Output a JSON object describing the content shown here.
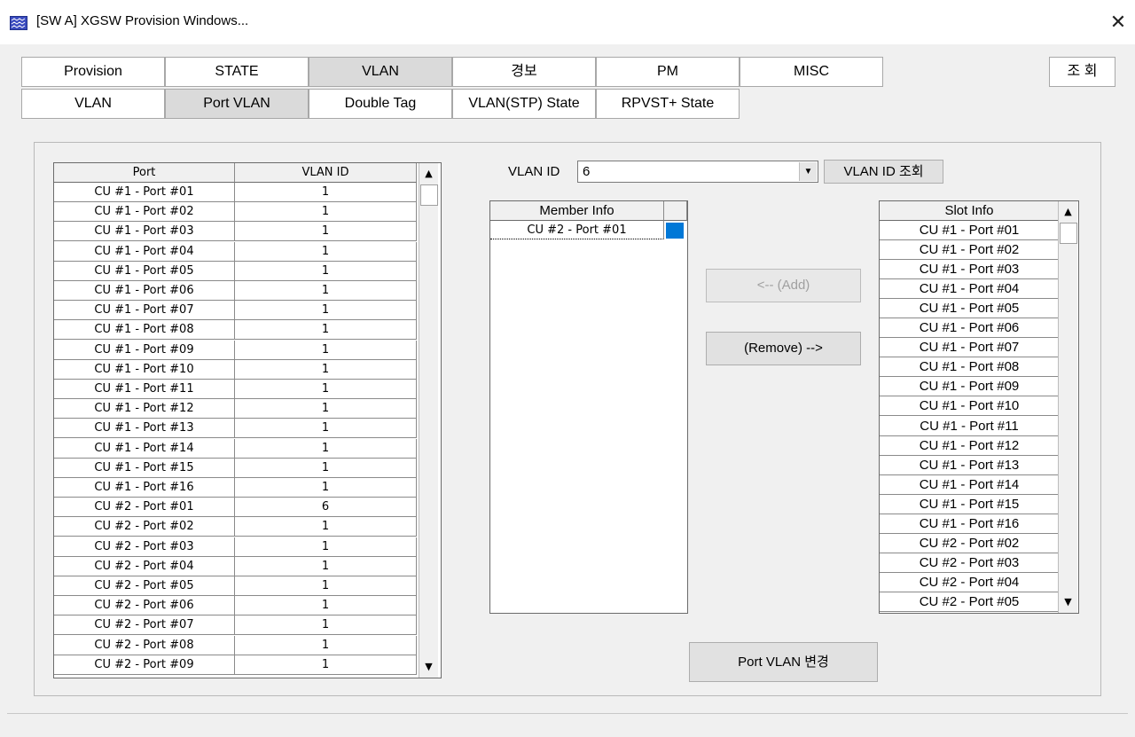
{
  "window": {
    "title": "[SW A] XGSW Provision Windows...",
    "close_glyph": "✕"
  },
  "top_tabs": [
    {
      "label": "Provision"
    },
    {
      "label": "STATE"
    },
    {
      "label": "VLAN"
    },
    {
      "label": "경보"
    },
    {
      "label": "PM"
    },
    {
      "label": "MISC"
    }
  ],
  "query_button": "조 회",
  "sub_tabs": [
    {
      "label": "VLAN"
    },
    {
      "label": "Port VLAN"
    },
    {
      "label": "Double Tag"
    },
    {
      "label": "VLAN(STP) State"
    },
    {
      "label": "RPVST+ State"
    }
  ],
  "port_table": {
    "headers": [
      "Port",
      "VLAN ID"
    ],
    "rows": [
      [
        "CU #1 - Port #01",
        "1"
      ],
      [
        "CU #1 - Port #02",
        "1"
      ],
      [
        "CU #1 - Port #03",
        "1"
      ],
      [
        "CU #1 - Port #04",
        "1"
      ],
      [
        "CU #1 - Port #05",
        "1"
      ],
      [
        "CU #1 - Port #06",
        "1"
      ],
      [
        "CU #1 - Port #07",
        "1"
      ],
      [
        "CU #1 - Port #08",
        "1"
      ],
      [
        "CU #1 - Port #09",
        "1"
      ],
      [
        "CU #1 - Port #10",
        "1"
      ],
      [
        "CU #1 - Port #11",
        "1"
      ],
      [
        "CU #1 - Port #12",
        "1"
      ],
      [
        "CU #1 - Port #13",
        "1"
      ],
      [
        "CU #1 - Port #14",
        "1"
      ],
      [
        "CU #1 - Port #15",
        "1"
      ],
      [
        "CU #1 - Port #16",
        "1"
      ],
      [
        "CU #2 - Port #01",
        "6"
      ],
      [
        "CU #2 - Port #02",
        "1"
      ],
      [
        "CU #2 - Port #03",
        "1"
      ],
      [
        "CU #2 - Port #04",
        "1"
      ],
      [
        "CU #2 - Port #05",
        "1"
      ],
      [
        "CU #2 - Port #06",
        "1"
      ],
      [
        "CU #2 - Port #07",
        "1"
      ],
      [
        "CU #2 - Port #08",
        "1"
      ],
      [
        "CU #2 - Port #09",
        "1"
      ]
    ]
  },
  "vlan_id": {
    "label": "VLAN ID",
    "value": "6",
    "lookup_button": "VLAN ID  조회"
  },
  "member_info": {
    "header": "Member Info",
    "rows": [
      "CU #2 - Port #01"
    ]
  },
  "add_button": "<-- (Add)",
  "remove_button": "(Remove) -->",
  "slot_info": {
    "header": "Slot Info",
    "rows": [
      "CU #1 - Port #01",
      "CU #1 - Port #02",
      "CU #1 - Port #03",
      "CU #1 - Port #04",
      "CU #1 - Port #05",
      "CU #1 - Port #06",
      "CU #1 - Port #07",
      "CU #1 - Port #08",
      "CU #1 - Port #09",
      "CU #1 - Port #10",
      "CU #1 - Port #11",
      "CU #1 - Port #12",
      "CU #1 - Port #13",
      "CU #1 - Port #14",
      "CU #1 - Port #15",
      "CU #1 - Port #16",
      "CU #2 - Port #02",
      "CU #2 - Port #03",
      "CU #2 - Port #04",
      "CU #2 - Port #05"
    ]
  },
  "apply_button": "Port VLAN 변경",
  "scroll_glyphs": {
    "up": "▲",
    "down": "▼"
  },
  "colors": {
    "selection": "#0078d7",
    "active_tab": "#dadada"
  }
}
